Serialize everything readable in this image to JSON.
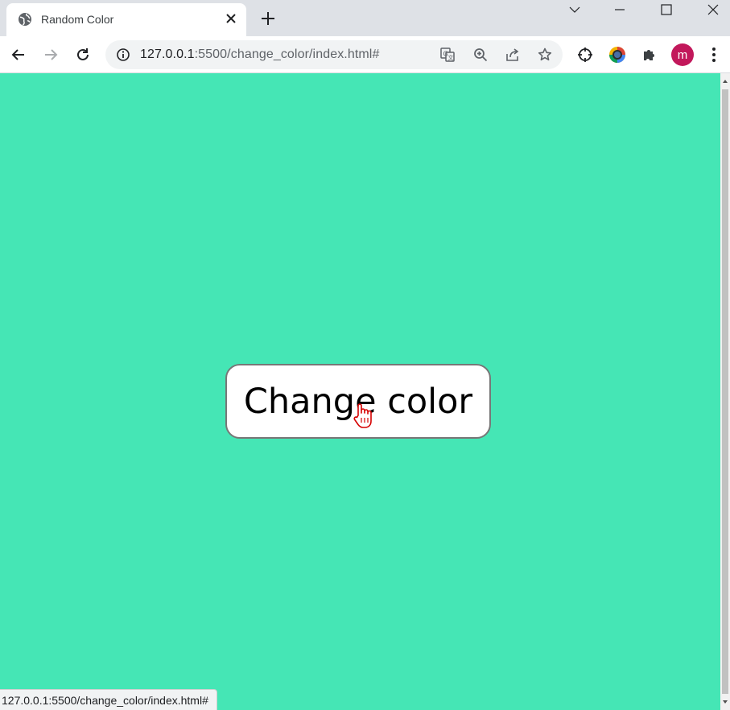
{
  "browser": {
    "tab": {
      "title": "Random Color"
    },
    "url": {
      "host": "127.0.0.1",
      "rest": ":5500/change_color/index.html#"
    },
    "profile_initial": "m",
    "profile_color": "#c2185b"
  },
  "page": {
    "background_color": "#45e6b5",
    "button_label": "Change color"
  },
  "statusbar": {
    "text": "127.0.0.1:5500/change_color/index.html#"
  },
  "icons": {
    "favicon": "globe-icon",
    "tab_close": "close-icon",
    "new_tab": "plus-icon",
    "back": "arrow-left-icon",
    "forward": "arrow-right-icon",
    "reload": "reload-icon",
    "site_info": "info-icon",
    "translate": "translate-icon",
    "zoom": "zoom-in-icon",
    "share": "share-icon",
    "bookmark": "star-icon",
    "extensions": "puzzle-icon",
    "menu": "kebab-menu-icon"
  }
}
